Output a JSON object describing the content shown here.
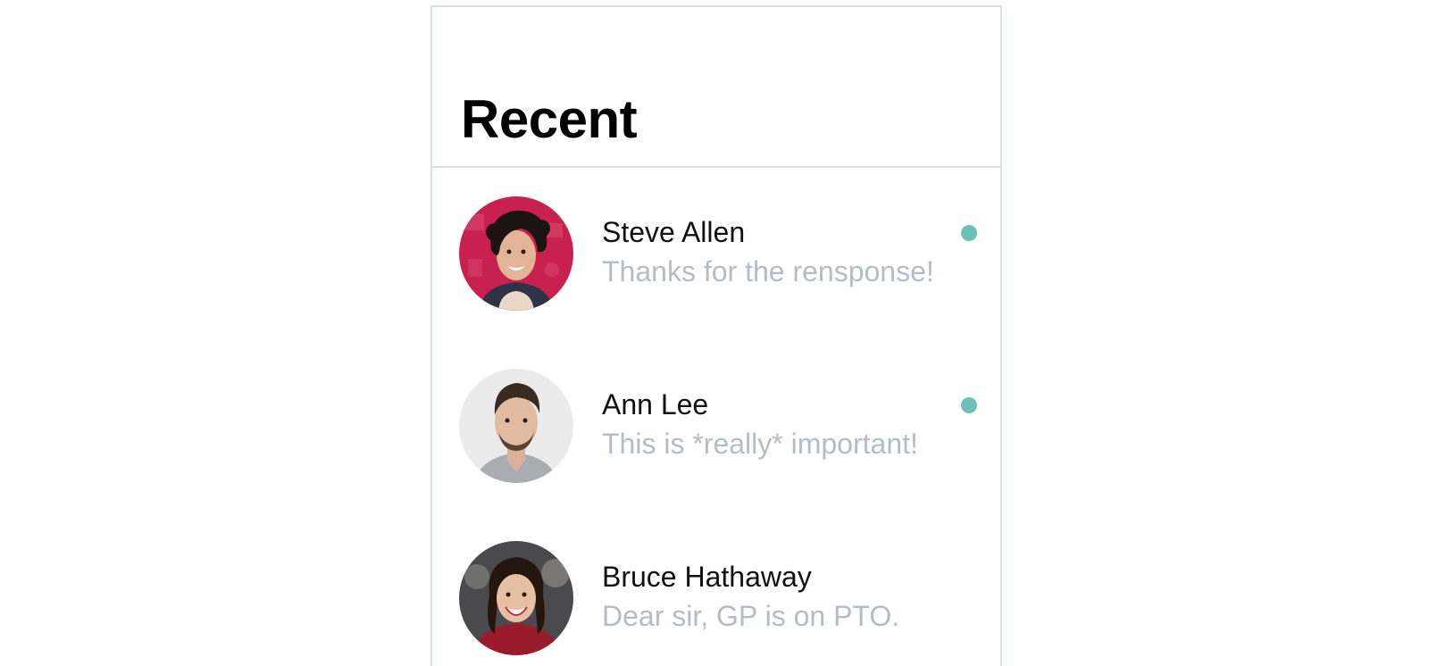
{
  "header": {
    "title": "Recent"
  },
  "colors": {
    "unread": "#6dbfb8",
    "preview_text": "#b5bcc4",
    "border": "#d9e0e5"
  },
  "conversations": [
    {
      "name": "Steve Allen",
      "preview": "Thanks for the rensponse!",
      "unread": true,
      "avatar": "avatar-curly-hair-red-background"
    },
    {
      "name": "Ann Lee",
      "preview": "This is *really* important!",
      "unread": true,
      "avatar": "avatar-man-grey-background"
    },
    {
      "name": "Bruce Hathaway",
      "preview": "Dear sir, GP is on PTO.",
      "unread": false,
      "avatar": "avatar-woman-red-sweater"
    }
  ]
}
